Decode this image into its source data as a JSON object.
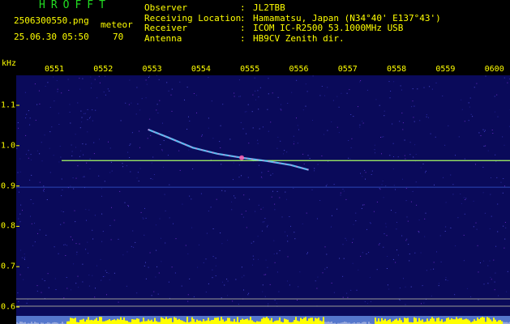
{
  "header": {
    "app_title": "HROFFT",
    "file_name": "2506300550.png",
    "datetime": "25.06.30 05:50",
    "mode_label": "meteor",
    "mode_count": "70"
  },
  "station_info": [
    {
      "key": "Observer",
      "value": "JL2TBB"
    },
    {
      "key": "Receiving Location",
      "value": "Hamamatsu, Japan (N34°40' E137°43')"
    },
    {
      "key": "Receiver",
      "value": "ICOM IC-R2500 53.1000MHz USB"
    },
    {
      "key": "Antenna",
      "value": "HB9CV Zenith dir."
    }
  ],
  "chart_data": {
    "type": "spectrogram",
    "x_tick_labels": [
      "0551",
      "0552",
      "0553",
      "0554",
      "0555",
      "0556",
      "0557",
      "0558",
      "0559",
      "0600"
    ],
    "y_unit": "kHz",
    "y_tick_labels": [
      "1.1",
      "1.0",
      "0.9",
      "0.8",
      "0.7",
      "0.6"
    ],
    "y_ticks": [
      1.1,
      1.0,
      0.9,
      0.8,
      0.7,
      0.6
    ],
    "ylim": [
      0.58,
      1.14
    ],
    "carrier_khz": 0.963,
    "secondary_line_khz": 0.897,
    "meteor_trace": [
      {
        "t": "0552:55",
        "khz": 1.04
      },
      {
        "t": "0553:20",
        "khz": 1.02
      },
      {
        "t": "0553:50",
        "khz": 0.995
      },
      {
        "t": "0554:20",
        "khz": 0.98
      },
      {
        "t": "0554:50",
        "khz": 0.97
      },
      {
        "t": "0555:20",
        "khz": 0.962
      },
      {
        "t": "0555:50",
        "khz": 0.952
      },
      {
        "t": "0556:12",
        "khz": 0.94
      }
    ],
    "colors": {
      "background": "#0a0a5a",
      "carrier": "#aaff66",
      "trace": "#66ccff",
      "noise_band": "#ffff00",
      "labels": "#ffff00"
    }
  }
}
